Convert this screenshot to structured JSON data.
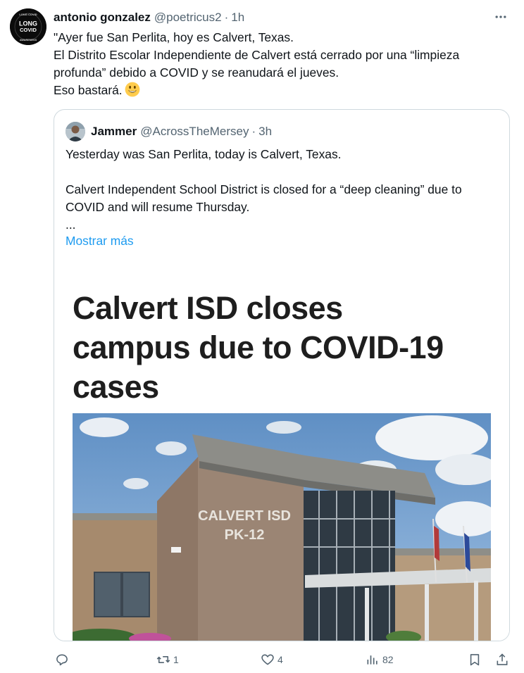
{
  "tweet": {
    "author_name": "antonio gonzalez",
    "author_handle": "@poetricus2",
    "separator": "·",
    "timestamp": "1h",
    "avatar_text": {
      "top": "LONG COVID",
      "line1": "LONG",
      "line2": "COVID",
      "bottom": "AWARENESS"
    },
    "text_lines": [
      "\"Ayer fue San Perlita, hoy es Calvert, Texas.",
      "El Distrito Escolar Independiente de Calvert está cerrado por una “limpieza",
      "profunda” debido a COVID y se reanudará el jueves.",
      "Eso bastará."
    ],
    "emoji": "smiley-emoji"
  },
  "quote": {
    "author_name": "Jammer",
    "author_handle": "@AcrossTheMersey",
    "separator": "·",
    "timestamp": "3h",
    "text_lines": [
      "Yesterday was San Perlita, today is Calvert, Texas.",
      "",
      "Calvert Independent School District is closed for a “deep cleaning” due to",
      "COVID and will resume Thursday.",
      "..."
    ],
    "show_more": "Mostrar más",
    "media": {
      "headline_lines": [
        "Calvert ISD closes",
        "campus due to COVID-19",
        "cases"
      ],
      "building_sign_line1": "CALVERT ISD",
      "building_sign_line2": "PK-12"
    }
  },
  "actions": {
    "reply_icon": "reply-icon",
    "retweet_count": "1",
    "like_count": "4",
    "views_count": "82",
    "bookmark_icon": "bookmark-icon",
    "share_icon": "share-icon"
  },
  "colors": {
    "text_primary": "#0f1419",
    "text_secondary": "#536471",
    "link": "#1d9bf0",
    "border": "#cfd9de"
  }
}
